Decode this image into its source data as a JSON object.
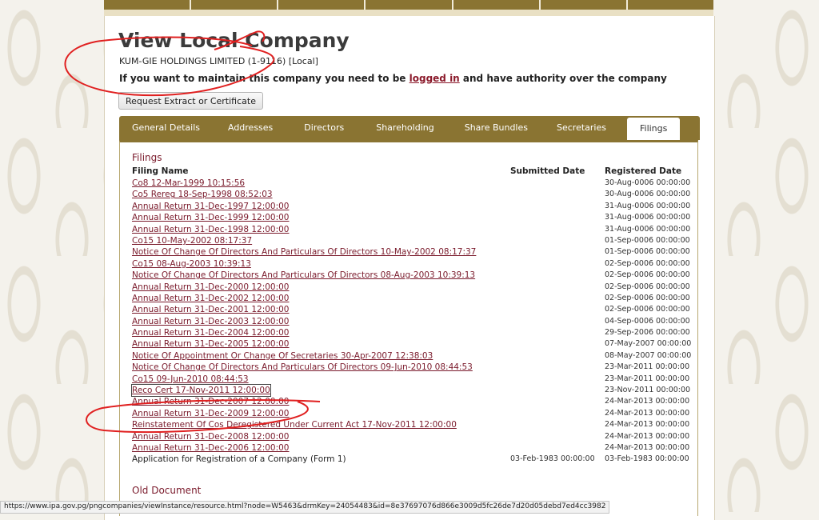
{
  "page": {
    "title": "View Local Company",
    "company_line": "KUM-GIE HOLDINGS LIMITED (1-9116) [Local]",
    "notice_before": "If you want to maintain this company you need to be ",
    "notice_link": "logged in",
    "notice_after": " and have authority over the company",
    "request_button": "Request Extract or Certificate"
  },
  "tabs": [
    {
      "label": "General Details"
    },
    {
      "label": "Addresses"
    },
    {
      "label": "Directors"
    },
    {
      "label": "Shareholding"
    },
    {
      "label": "Share Bundles"
    },
    {
      "label": "Secretaries"
    },
    {
      "label": "Filings"
    }
  ],
  "filings": {
    "section_title": "Filings",
    "headers": {
      "name": "Filing Name",
      "submitted": "Submitted Date",
      "registered": "Registered Date"
    },
    "rows": [
      {
        "name": "Co8 12-Mar-1999 10:15:56",
        "submitted": "",
        "registered": "30-Aug-0006 00:00:00"
      },
      {
        "name": "Co5 Rereg 18-Sep-1998 08:52:03",
        "submitted": "",
        "registered": "30-Aug-0006 00:00:00"
      },
      {
        "name": "Annual Return 31-Dec-1997 12:00:00",
        "submitted": "",
        "registered": "31-Aug-0006 00:00:00"
      },
      {
        "name": "Annual Return 31-Dec-1999 12:00:00",
        "submitted": "",
        "registered": "31-Aug-0006 00:00:00"
      },
      {
        "name": "Annual Return 31-Dec-1998 12:00:00",
        "submitted": "",
        "registered": "31-Aug-0006 00:00:00"
      },
      {
        "name": "Co15 10-May-2002 08:17:37",
        "submitted": "",
        "registered": "01-Sep-0006 00:00:00"
      },
      {
        "name": "Notice Of Change Of Directors And Particulars Of Directors 10-May-2002 08:17:37",
        "submitted": "",
        "registered": "01-Sep-0006 00:00:00"
      },
      {
        "name": "Co15 08-Aug-2003 10:39:13",
        "submitted": "",
        "registered": "02-Sep-0006 00:00:00"
      },
      {
        "name": "Notice Of Change Of Directors And Particulars Of Directors 08-Aug-2003 10:39:13",
        "submitted": "",
        "registered": "02-Sep-0006 00:00:00"
      },
      {
        "name": "Annual Return 31-Dec-2000 12:00:00",
        "submitted": "",
        "registered": "02-Sep-0006 00:00:00"
      },
      {
        "name": "Annual Return 31-Dec-2002 12:00:00",
        "submitted": "",
        "registered": "02-Sep-0006 00:00:00"
      },
      {
        "name": "Annual Return 31-Dec-2001 12:00:00",
        "submitted": "",
        "registered": "02-Sep-0006 00:00:00"
      },
      {
        "name": "Annual Return 31-Dec-2003 12:00:00",
        "submitted": "",
        "registered": "04-Sep-0006 00:00:00"
      },
      {
        "name": "Annual Return 31-Dec-2004 12:00:00",
        "submitted": "",
        "registered": "29-Sep-2006 00:00:00"
      },
      {
        "name": "Annual Return 31-Dec-2005 12:00:00",
        "submitted": "",
        "registered": "07-May-2007 00:00:00"
      },
      {
        "name": "Notice Of Appointment Or Change Of Secretaries 30-Apr-2007 12:38:03",
        "submitted": "",
        "registered": "08-May-2007 00:00:00"
      },
      {
        "name": "Notice Of Change Of Directors And Particulars Of Directors 09-Jun-2010 08:44:53",
        "submitted": "",
        "registered": "23-Mar-2011 00:00:00"
      },
      {
        "name": "Co15 09-Jun-2010 08:44:53",
        "submitted": "",
        "registered": "23-Mar-2011 00:00:00"
      },
      {
        "name": "Reco Cert 17-Nov-2011 12:00:00",
        "submitted": "",
        "registered": "23-Nov-2011 00:00:00",
        "focused": true
      },
      {
        "name": "Annual Return 31-Dec-2007 12:00:00",
        "submitted": "",
        "registered": "24-Mar-2013 00:00:00"
      },
      {
        "name": "Annual Return 31-Dec-2009 12:00:00",
        "submitted": "",
        "registered": "24-Mar-2013 00:00:00"
      },
      {
        "name": "Reinstatement Of Cos Deregistered Under Current Act 17-Nov-2011 12:00:00",
        "submitted": "",
        "registered": "24-Mar-2013 00:00:00"
      },
      {
        "name": "Annual Return 31-Dec-2008 12:00:00",
        "submitted": "",
        "registered": "24-Mar-2013 00:00:00"
      },
      {
        "name": "Annual Return 31-Dec-2006 12:00:00",
        "submitted": "",
        "registered": "24-Mar-2013 00:00:00"
      },
      {
        "name": "Application for Registration of a Company (Form 1)",
        "submitted": "03-Feb-1983 00:00:00",
        "registered": "03-Feb-1983 00:00:00",
        "link": false
      }
    ]
  },
  "old_document": {
    "title": "Old Document"
  },
  "status_bar": {
    "url": "https://www.ipa.gov.pg/pngcompanies/viewInstance/resource.html?node=W5463&drmKey=24054483&id=8e37697076d866e3009d5fc26de7d20d05debd7ed4cc3982"
  },
  "colors": {
    "accent": "#8a7432",
    "link": "#7a1a2b",
    "annotation": "#e02020"
  }
}
